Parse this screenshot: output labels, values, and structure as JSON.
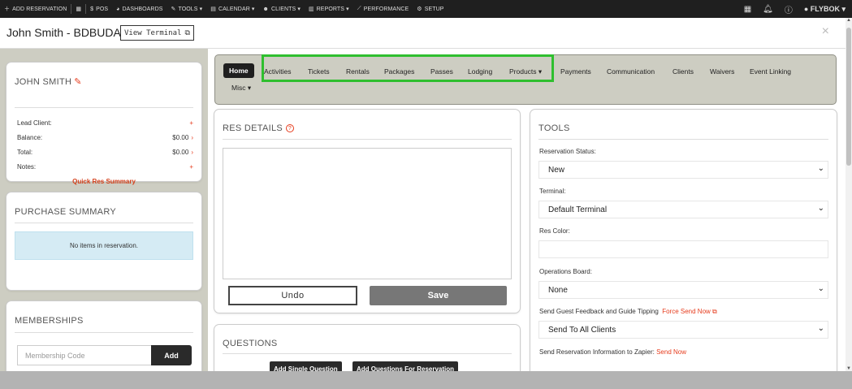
{
  "topbar": {
    "items": [
      {
        "icon": "plus-icon",
        "label": "ADD RESERVATION"
      },
      {
        "icon": "grid-icon",
        "label": ""
      },
      {
        "icon": "dollar-icon",
        "label": "POS"
      },
      {
        "icon": "gauge-icon",
        "label": "DASHBOARDS"
      },
      {
        "icon": "wrench-icon",
        "label": "TOOLS ▾"
      },
      {
        "icon": "calendar-icon",
        "label": "CALENDAR ▾"
      },
      {
        "icon": "users-icon",
        "label": "CLIENTS ▾"
      },
      {
        "icon": "report-icon",
        "label": "REPORTS ▾"
      },
      {
        "icon": "chart-icon",
        "label": "PERFORMANCE"
      },
      {
        "icon": "gear-icon",
        "label": "SETUP"
      }
    ],
    "brand": "FLYBOK ▾"
  },
  "header": {
    "title": "John Smith - BDBUDA",
    "view_terminal": "View Terminal",
    "close": "×"
  },
  "client_card": {
    "name": "JOHN SMITH",
    "rows": [
      {
        "label": "Lead Client:",
        "value": "",
        "action": "+"
      },
      {
        "label": "Balance:",
        "value": "$0.00",
        "action": "›"
      },
      {
        "label": "Total:",
        "value": "$0.00",
        "action": "›"
      },
      {
        "label": "Notes:",
        "value": "",
        "action": "+"
      }
    ],
    "quick_res": "Quick Res Summary"
  },
  "purchase_summary": {
    "title": "PURCHASE SUMMARY",
    "empty": "No items in reservation."
  },
  "memberships": {
    "title": "MEMBERSHIPS",
    "placeholder": "Membership Code",
    "add": "Add"
  },
  "tabs": {
    "home": "Home",
    "items": [
      "Activities",
      "Tickets",
      "Rentals",
      "Packages",
      "Passes",
      "Lodging",
      "Products ▾",
      "Payments",
      "Communication",
      "Clients",
      "Waivers",
      "Event Linking"
    ],
    "misc": "Misc ▾"
  },
  "res_details": {
    "title": "RES DETAILS",
    "undo": "Undo",
    "save": "Save"
  },
  "questions": {
    "title": "QUESTIONS",
    "add_single": "Add Single Question",
    "add_for_res": "Add Questions For Reservation"
  },
  "tools": {
    "title": "TOOLS",
    "reservation_status_label": "Reservation Status:",
    "reservation_status_value": "New",
    "terminal_label": "Terminal:",
    "terminal_value": "Default Terminal",
    "res_color_label": "Res Color:",
    "operations_board_label": "Operations Board:",
    "operations_board_value": "None",
    "feedback_label": "Send Guest Feedback and Guide Tipping",
    "force_send": "Force Send Now",
    "feedback_value": "Send To All Clients",
    "zapier_label": "Send Reservation Information to Zapier:",
    "send_now": "Send Now"
  },
  "colors": {
    "accent_red": "#e63b1c",
    "highlight_green": "#2fbf2f",
    "dark": "#1f1f1f"
  }
}
